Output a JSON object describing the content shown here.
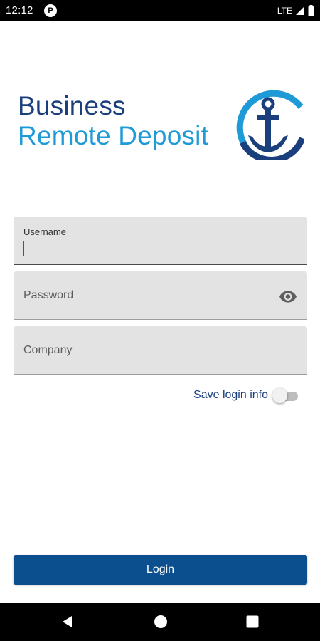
{
  "status_bar": {
    "time": "12:12",
    "app_icon_glyph": "P",
    "network": "LTE",
    "icons": [
      "signal-icon",
      "battery-icon"
    ]
  },
  "logo": {
    "line1": "Business",
    "line2": "Remote Deposit",
    "icon": "anchor-icon",
    "colors": {
      "line1": "#1b3f7c",
      "line2": "#1e9ad6",
      "icon_ring_light": "#1e9ad6",
      "icon_ring_dark": "#1b3f7c"
    }
  },
  "form": {
    "username": {
      "label": "Username",
      "value": ""
    },
    "password": {
      "placeholder": "Password",
      "value": "",
      "icon": "eye-icon"
    },
    "company": {
      "placeholder": "Company",
      "value": ""
    },
    "save_login": {
      "label": "Save login info",
      "enabled": false
    }
  },
  "login_button": {
    "label": "Login",
    "color": "#0b4f8e"
  },
  "nav_bar": {
    "icons": [
      "back-icon",
      "home-icon",
      "recents-icon"
    ]
  }
}
